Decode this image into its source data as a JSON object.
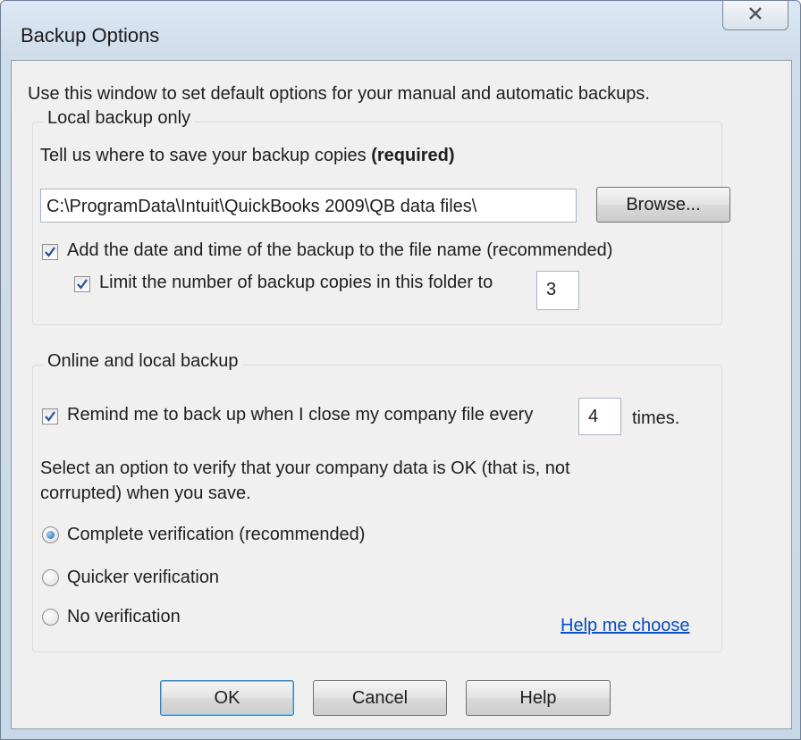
{
  "window": {
    "title": "Backup Options"
  },
  "intro": "Use this window to set default options for your manual and automatic backups.",
  "local_backup": {
    "legend": "Local backup only",
    "save_label": "Tell us where to save your backup copies",
    "save_required": "(required)",
    "path_value": "C:\\ProgramData\\Intuit\\QuickBooks 2009\\QB data files\\",
    "browse_label": "Browse...",
    "add_date_label": "Add the date and time of the backup to the file name (recommended)",
    "add_date_checked": true,
    "limit_label": "Limit the number of backup copies in this folder to",
    "limit_checked": true,
    "limit_value": "3"
  },
  "online_backup": {
    "legend": "Online and local backup",
    "remind_label": "Remind me to back up when I close my company file every",
    "remind_checked": true,
    "remind_value": "4",
    "remind_suffix": "times.",
    "verify_prompt_line1": "Select an option to verify that your company data is OK (that is, not",
    "verify_prompt_line2": "corrupted) when you save.",
    "options": [
      {
        "label": "Complete verification (recommended)",
        "selected": true
      },
      {
        "label": "Quicker verification",
        "selected": false
      },
      {
        "label": "No verification",
        "selected": false
      }
    ],
    "help_link": "Help me choose"
  },
  "buttons": {
    "ok": "OK",
    "cancel": "Cancel",
    "help": "Help"
  },
  "icons": {
    "close": "close-icon",
    "check": "checkmark-icon"
  },
  "colors": {
    "link": "#0a4cc2",
    "check": "#2a4f93",
    "radio_dot": "#1a5ea8"
  }
}
